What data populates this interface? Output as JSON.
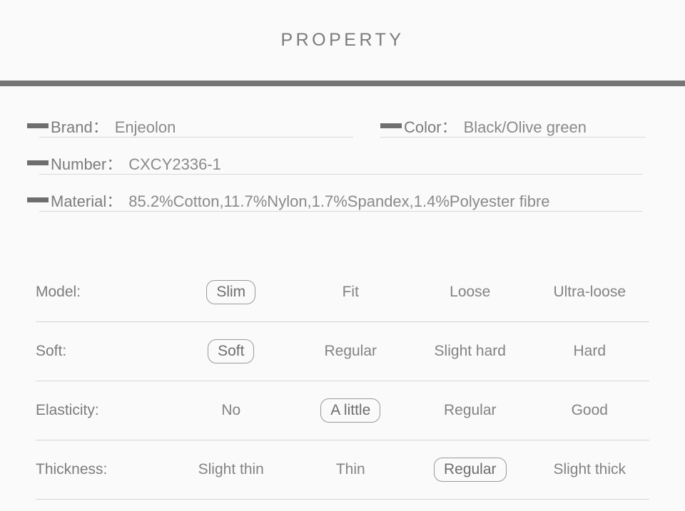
{
  "header": {
    "title": "PROPERTY"
  },
  "colors": {
    "background": "#fafafa",
    "divider": "#757575",
    "text": "#7c7c7c",
    "value_text": "#8a8a8a",
    "rule": "#d5d5d5",
    "pill_border": "#9a9a9a"
  },
  "info": {
    "brand": {
      "label": "Brand：",
      "value": "Enjeolon"
    },
    "color": {
      "label": "Color：",
      "value": "Black/Olive green"
    },
    "number": {
      "label": "Number：",
      "value": "CXCY2336-1"
    },
    "material": {
      "label": "Material：",
      "value": "85.2%Cotton,11.7%Nylon,1.7%Spandex,1.4%Polyester fibre"
    }
  },
  "spec_table": {
    "rows": [
      {
        "label": "Model:",
        "options": [
          {
            "text": "Slim",
            "selected": true
          },
          {
            "text": "Fit",
            "selected": false
          },
          {
            "text": "Loose",
            "selected": false
          },
          {
            "text": "Ultra-loose",
            "selected": false
          }
        ]
      },
      {
        "label": "Soft:",
        "options": [
          {
            "text": "Soft",
            "selected": true
          },
          {
            "text": "Regular",
            "selected": false
          },
          {
            "text": "Slight hard",
            "selected": false
          },
          {
            "text": "Hard",
            "selected": false
          }
        ]
      },
      {
        "label": "Elasticity:",
        "options": [
          {
            "text": "No",
            "selected": false
          },
          {
            "text": "A little",
            "selected": true
          },
          {
            "text": "Regular",
            "selected": false
          },
          {
            "text": "Good",
            "selected": false
          }
        ]
      },
      {
        "label": "Thickness:",
        "options": [
          {
            "text": "Slight thin",
            "selected": false
          },
          {
            "text": "Thin",
            "selected": false
          },
          {
            "text": "Regular",
            "selected": true
          },
          {
            "text": "Slight thick",
            "selected": false
          }
        ]
      }
    ]
  }
}
